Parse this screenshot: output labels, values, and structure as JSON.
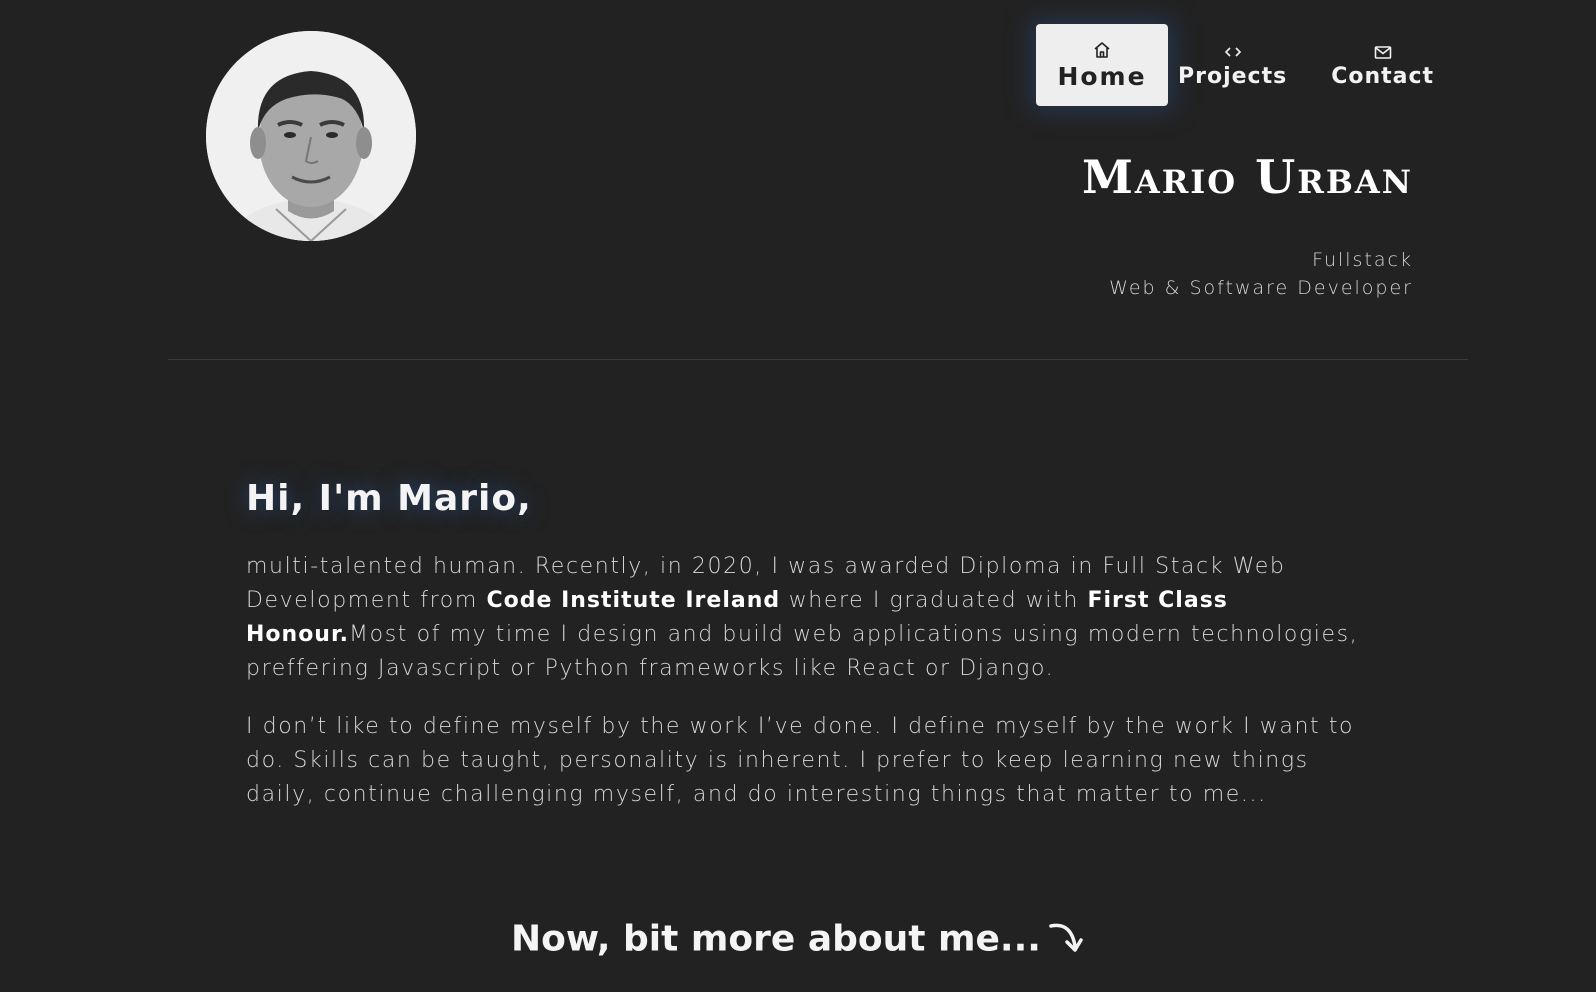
{
  "header": {
    "avatar_alt": "Mario Urban portrait",
    "nav": [
      {
        "label": "Home",
        "icon": "home-icon",
        "active": true
      },
      {
        "label": "Projects",
        "icon": "code-icon",
        "active": false
      },
      {
        "label": "Contact",
        "icon": "mail-icon",
        "active": false
      }
    ],
    "name": "Mario Urban",
    "role_line1": "Fullstack",
    "role_line2": "Web & Software Developer"
  },
  "intro": {
    "greeting": "Hi, I'm Mario,",
    "para1": {
      "text_a": "multi-talented human. Recently, in 2020, I was awarded Diploma in Full Stack Web Development from ",
      "bold_a": "Code Institute Ireland",
      "text_b": " where I graduated with ",
      "bold_b": "First Class Honour.",
      "text_c": "Most of my time I design and build web applications using modern technologies, preffering Javascript or Python frameworks like React or Django."
    },
    "para2": "I don’t like to define myself by the work I’ve done. I define myself by the work I want to do. Skills can be taught, personality is inherent. I prefer to keep learning new things daily, continue challenging myself, and do interesting things that matter to me..."
  },
  "more_link": "Now, bit more about me...",
  "colors": {
    "background": "#222222",
    "active_nav_bg": "#eeeeee",
    "glow": "#28466e"
  }
}
